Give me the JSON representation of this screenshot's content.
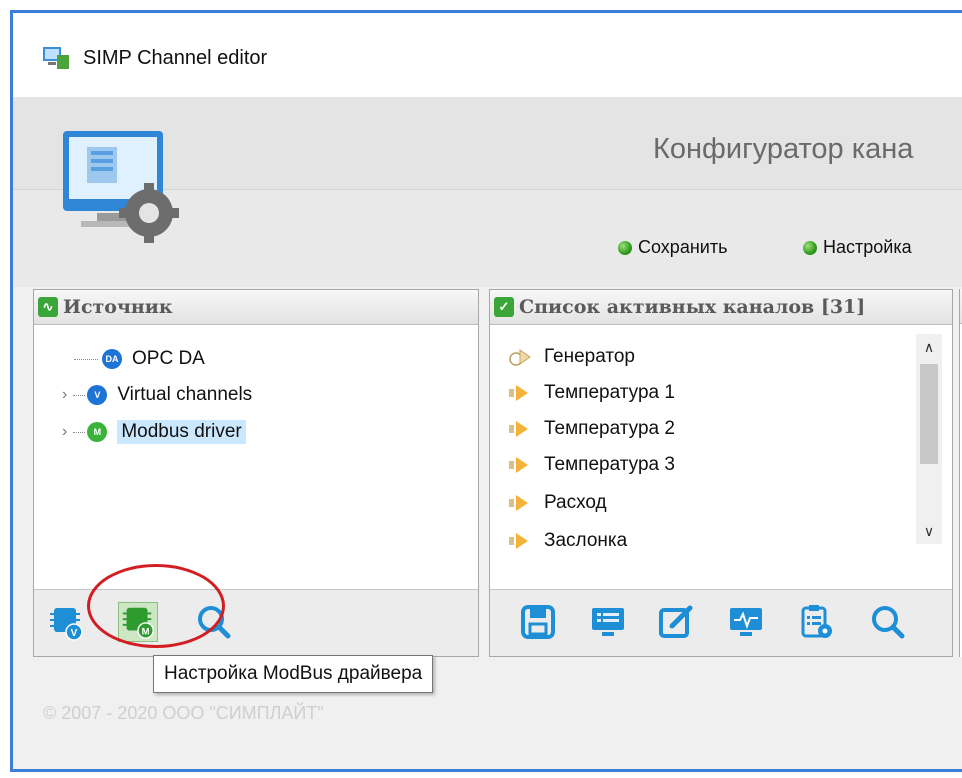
{
  "window": {
    "title": "SIMP Channel editor"
  },
  "header": {
    "title": "Конфигуратор кана",
    "toolbar": {
      "save_label": "Сохранить",
      "settings_label": "Настройка"
    }
  },
  "source_panel": {
    "title": "Источник",
    "tree": [
      {
        "badge": "DA",
        "label": "OPC DA",
        "color": "#1e73d6"
      },
      {
        "badge": "V",
        "label": "Virtual channels",
        "color": "#1e73d6"
      },
      {
        "badge": "M",
        "label": "Modbus driver",
        "color": "#3bb33b"
      }
    ]
  },
  "channels_panel": {
    "title": "Список активных каналов [31]",
    "items": [
      "Генератор",
      "Температура 1",
      "Температура 2",
      "Температура 3",
      "Расход",
      "Заслонка"
    ]
  },
  "tooltip": "Настройка ModBus драйвера",
  "footer": {
    "copyright": "© 2007 - 2020 ООО \"СИМПЛАЙТ\""
  },
  "colors": {
    "accent": "#3b7fd6",
    "ok_green": "#2f9a1e",
    "highlight_red": "#d21e23",
    "icon_blue": "#1e8fd6"
  }
}
